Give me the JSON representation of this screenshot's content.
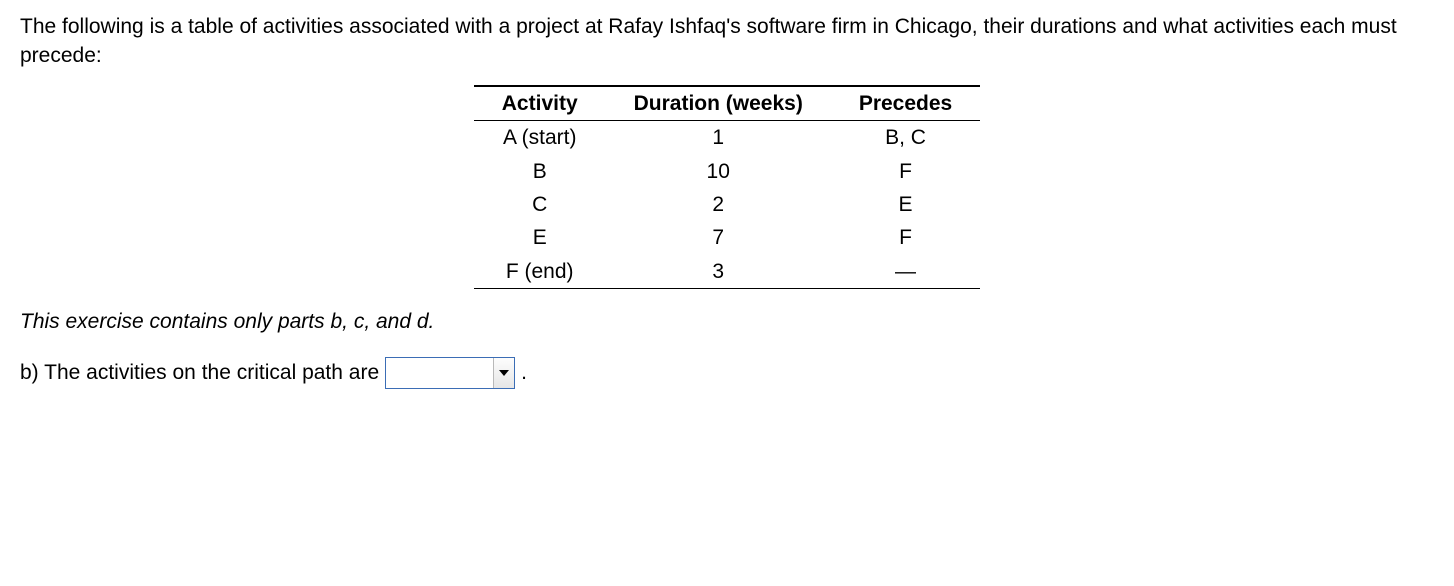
{
  "intro": "The following is a table of activities associated with a project at Rafay Ishfaq's software firm in Chicago, their durations and what activities each must precede:",
  "table": {
    "headers": {
      "activity": "Activity",
      "duration": "Duration (weeks)",
      "precedes": "Precedes"
    },
    "rows": [
      {
        "activity": "A (start)",
        "duration": "1",
        "precedes": "B, C"
      },
      {
        "activity": "B",
        "duration": "10",
        "precedes": "F"
      },
      {
        "activity": "C",
        "duration": "2",
        "precedes": "E"
      },
      {
        "activity": "E",
        "duration": "7",
        "precedes": "F"
      },
      {
        "activity": "F (end)",
        "duration": "3",
        "precedes": "—"
      }
    ]
  },
  "note": "This exercise contains only parts b, c, and d.",
  "question_b": {
    "prompt": "b) The activities on the critical path are",
    "dropdown_value": "",
    "period": "."
  }
}
